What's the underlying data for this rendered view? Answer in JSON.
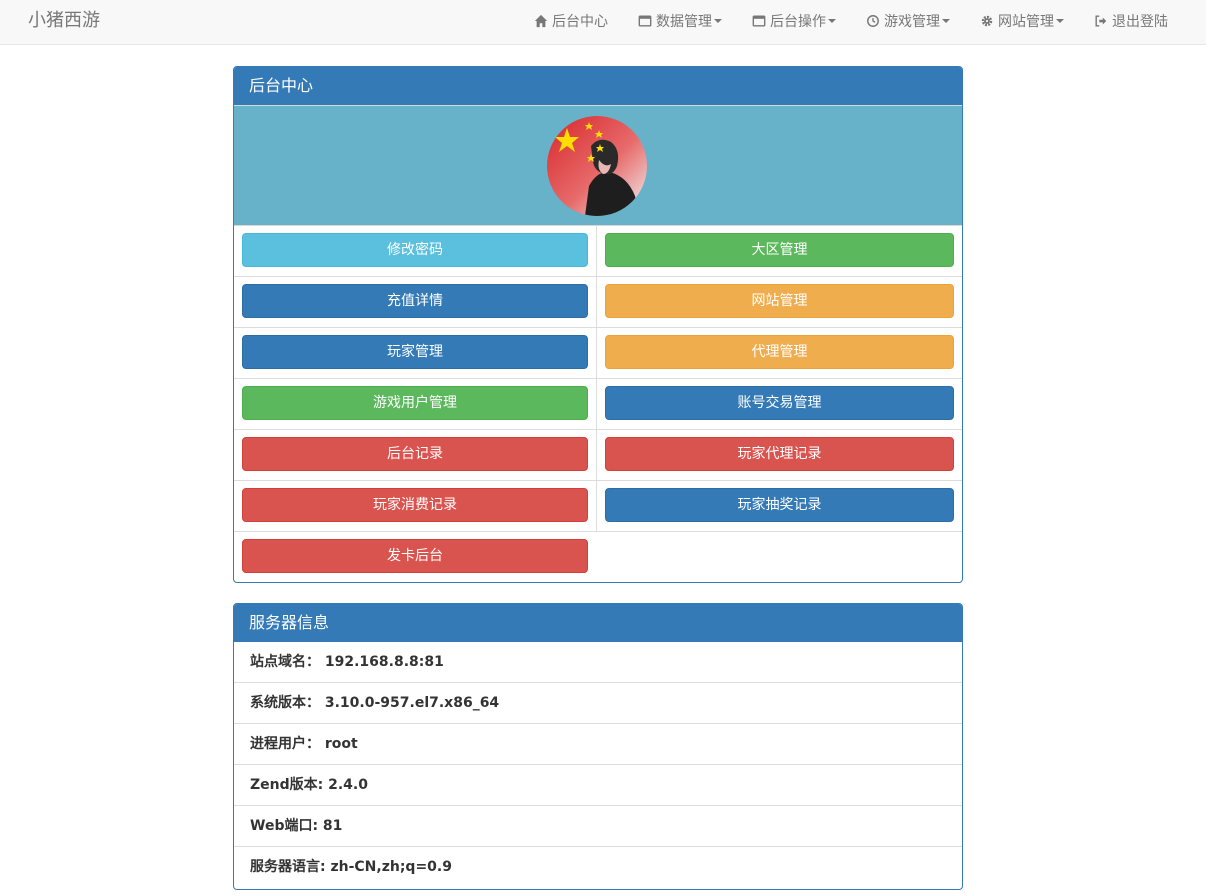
{
  "navbar": {
    "brand": "小猪西游",
    "items": [
      {
        "label": "后台中心",
        "icon": "home-icon",
        "dropdown": false
      },
      {
        "label": "数据管理",
        "icon": "window-icon",
        "dropdown": true
      },
      {
        "label": "后台操作",
        "icon": "window-icon",
        "dropdown": true
      },
      {
        "label": "游戏管理",
        "icon": "clock-icon",
        "dropdown": true
      },
      {
        "label": "网站管理",
        "icon": "gear-icon",
        "dropdown": true
      },
      {
        "label": "退出登陆",
        "icon": "logout-icon",
        "dropdown": false
      }
    ]
  },
  "admin_panel": {
    "title": "后台中心",
    "avatar": "avatar-image",
    "buttons": [
      {
        "label": "修改密码",
        "color": "#5bc0de"
      },
      {
        "label": "大区管理",
        "color": "#5cb85c"
      },
      {
        "label": "充值详情",
        "color": "#337ab7"
      },
      {
        "label": "网站管理",
        "color": "#f0ad4e"
      },
      {
        "label": "玩家管理",
        "color": "#337ab7"
      },
      {
        "label": "代理管理",
        "color": "#f0ad4e"
      },
      {
        "label": "游戏用户管理",
        "color": "#5cb85c"
      },
      {
        "label": "账号交易管理",
        "color": "#337ab7"
      },
      {
        "label": "后台记录",
        "color": "#d9534f"
      },
      {
        "label": "玩家代理记录",
        "color": "#d9534f"
      },
      {
        "label": "玩家消费记录",
        "color": "#d9534f"
      },
      {
        "label": "玩家抽奖记录",
        "color": "#337ab7"
      },
      {
        "label": "发卡后台",
        "color": "#d9534f"
      }
    ]
  },
  "server_panel": {
    "title": "服务器信息",
    "rows": [
      "站点域名：  192.168.8.8:81",
      "系统版本：  3.10.0-957.el7.x86_64",
      "进程用户：  root",
      "Zend版本: 2.4.0",
      "Web端口: 81",
      "服务器语言: zh-CN,zh;q=0.9"
    ]
  },
  "colors": {
    "primary": "#337ab7",
    "avatar_bg": "#67b1c9"
  }
}
